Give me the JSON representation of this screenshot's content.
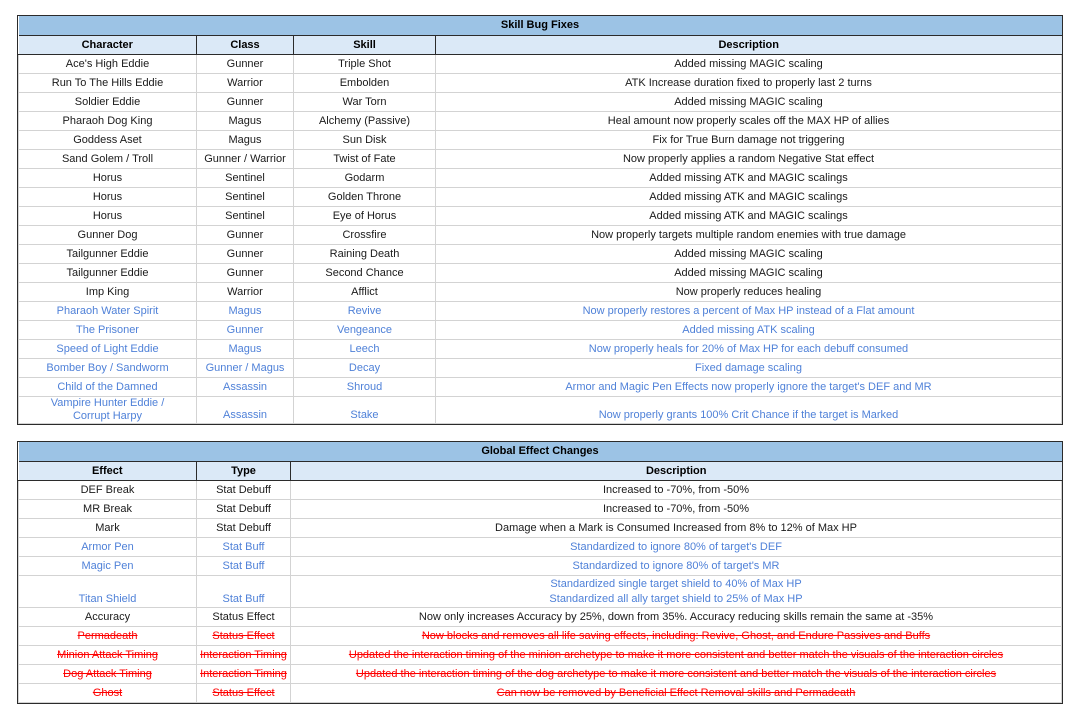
{
  "colors": {
    "title_band": "#9cc3e5",
    "header_band": "#dbe9f7",
    "text_default": "#1a1a1a",
    "text_blue": "#4f81d8",
    "text_red": "#fe0000",
    "grid_line": "#d3d3d3",
    "outer_border": "#2b2b2b"
  },
  "tables": [
    {
      "title": "Skill Bug Fixes",
      "columns": [
        "Character",
        "Class",
        "Skill",
        "Description"
      ],
      "rows": [
        {
          "character": "Ace's High Eddie",
          "class": "Gunner",
          "skill": "Triple Shot",
          "description": "Added missing MAGIC scaling",
          "style": "normal"
        },
        {
          "character": "Run To The Hills Eddie",
          "class": "Warrior",
          "skill": "Embolden",
          "description": "ATK Increase duration fixed to properly last 2 turns",
          "style": "normal"
        },
        {
          "character": "Soldier Eddie",
          "class": "Gunner",
          "skill": "War Torn",
          "description": "Added missing MAGIC scaling",
          "style": "normal"
        },
        {
          "character": "Pharaoh Dog King",
          "class": "Magus",
          "skill": "Alchemy (Passive)",
          "description": "Heal amount now properly scales off the MAX HP of allies",
          "style": "normal"
        },
        {
          "character": "Goddess Aset",
          "class": "Magus",
          "skill": "Sun Disk",
          "description": "Fix for True Burn damage not triggering",
          "style": "normal"
        },
        {
          "character": "Sand Golem / Troll",
          "class": "Gunner / Warrior",
          "skill": "Twist of Fate",
          "description": "Now properly applies a random Negative Stat effect",
          "style": "normal"
        },
        {
          "character": "Horus",
          "class": "Sentinel",
          "skill": "Godarm",
          "description": "Added missing ATK and MAGIC scalings",
          "style": "normal"
        },
        {
          "character": "Horus",
          "class": "Sentinel",
          "skill": "Golden Throne",
          "description": "Added missing ATK and MAGIC scalings",
          "style": "normal"
        },
        {
          "character": "Horus",
          "class": "Sentinel",
          "skill": "Eye of Horus",
          "description": "Added missing ATK and MAGIC scalings",
          "style": "normal"
        },
        {
          "character": "Gunner Dog",
          "class": "Gunner",
          "skill": "Crossfire",
          "description": "Now properly targets multiple random enemies with true damage",
          "style": "normal"
        },
        {
          "character": "Tailgunner Eddie",
          "class": "Gunner",
          "skill": "Raining Death",
          "description": "Added missing MAGIC scaling",
          "style": "normal"
        },
        {
          "character": "Tailgunner Eddie",
          "class": "Gunner",
          "skill": "Second Chance",
          "description": "Added missing MAGIC scaling",
          "style": "normal"
        },
        {
          "character": "Imp King",
          "class": "Warrior",
          "skill": "Afflict",
          "description": "Now properly reduces healing",
          "style": "normal"
        },
        {
          "character": "Pharaoh Water Spirit",
          "class": "Magus",
          "skill": "Revive",
          "description": "Now properly restores a percent of Max HP instead of a Flat amount",
          "style": "blue"
        },
        {
          "character": "The Prisoner",
          "class": "Gunner",
          "skill": "Vengeance",
          "description": "Added missing ATK scaling",
          "style": "blue"
        },
        {
          "character": "Speed of Light Eddie",
          "class": "Magus",
          "skill": "Leech",
          "description": "Now properly heals for 20% of Max HP for each debuff consumed",
          "style": "blue"
        },
        {
          "character": "Bomber Boy / Sandworm",
          "class": "Gunner / Magus",
          "skill": "Decay",
          "description": "Fixed damage scaling",
          "style": "blue"
        },
        {
          "character": "Child of the Damned",
          "class": "Assassin",
          "skill": "Shroud",
          "description": "Armor and Magic Pen Effects now properly ignore the target's DEF and MR",
          "style": "blue"
        },
        {
          "character": "Vampire Hunter Eddie /\nCorrupt Harpy",
          "class": "Assassin",
          "skill": "Stake",
          "description": "Now properly grants 100% Crit Chance if the target is Marked",
          "style": "blue",
          "tall": true
        }
      ]
    },
    {
      "title": "Global Effect Changes",
      "columns": [
        "Effect",
        "Type",
        "Description"
      ],
      "rows": [
        {
          "effect": "DEF Break",
          "type": "Stat Debuff",
          "description": "Increased to -70%, from -50%",
          "style": "normal"
        },
        {
          "effect": "MR Break",
          "type": "Stat Debuff",
          "description": "Increased to -70%, from -50%",
          "style": "normal"
        },
        {
          "effect": "Mark",
          "type": "Stat Debuff",
          "description": "Damage when a Mark is Consumed Increased from 8% to 12% of Max HP",
          "style": "normal"
        },
        {
          "effect": "Armor Pen",
          "type": "Stat Buff",
          "description": "Standardized to ignore 80% of target's DEF",
          "style": "blue"
        },
        {
          "effect": "Magic Pen",
          "type": "Stat Buff",
          "description": "Standardized to ignore 80% of target's MR",
          "style": "blue"
        },
        {
          "effect": "Titan Shield",
          "type": "Stat Buff",
          "description": "Standardized single target shield to 40% of Max HP\nStandardized all ally target shield to 25% of Max HP",
          "style": "blue",
          "tall": true
        },
        {
          "effect": "Accuracy",
          "type": "Status Effect",
          "description": "Now only increases Accuracy by 25%, down from 35%. Accuracy reducing skills remain the same at -35%",
          "style": "normal"
        },
        {
          "effect": "Permadeath",
          "type": "Status Effect",
          "description": "Now blocks and removes all life saving effects, including: Revive, Ghost, and Endure Passives and Buffs",
          "style": "red"
        },
        {
          "effect": "Minion Attack Timing",
          "type": "Interaction Timing",
          "description": "Updated the interaction timing of the minion archetype to make it more consistent and better match the visuals of the interaction circles",
          "style": "red"
        },
        {
          "effect": "Dog Attack Timing",
          "type": "Interaction Timing",
          "description": "Updated the interaction timing of the dog archetype to make it more consistent and better match the visuals of the interaction circles",
          "style": "red"
        },
        {
          "effect": "Ghost",
          "type": "Status Effect",
          "description": "Can now be removed by Beneficial Effect Removal skills and Permadeath",
          "style": "red"
        }
      ]
    }
  ]
}
